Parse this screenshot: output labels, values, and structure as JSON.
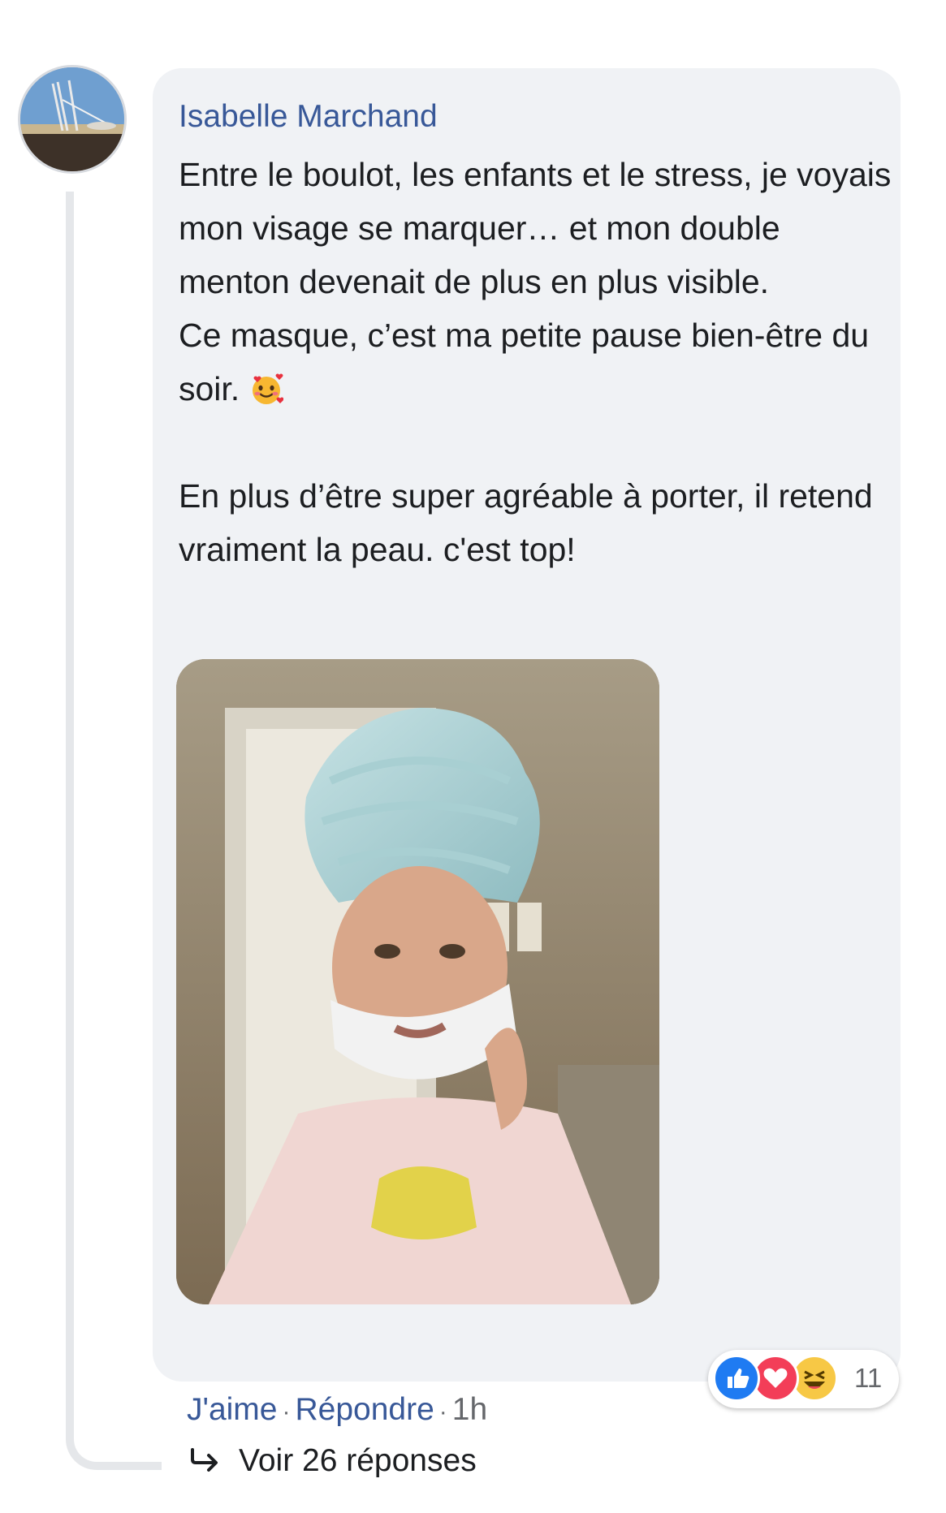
{
  "comment": {
    "author": "Isabelle Marchand",
    "paragraphs": [
      "Entre le boulot, les enfants et le stress, je voyais mon visage se marquer… et mon double menton devenait de plus en plus visible.",
      "Ce masque, c’est ma petite pause bien-être du soir.",
      "En plus d’être super agréable à porter, il retend vraiment la peau. c'est top!"
    ],
    "emoji": "smiling-face-with-hearts-icon"
  },
  "reactions": {
    "types": [
      "like-icon",
      "love-icon",
      "haha-icon"
    ],
    "count": "11",
    "colors": {
      "like": "#1f7bf2",
      "love": "#f33e58",
      "haha": "#f7c845"
    }
  },
  "actions": {
    "like": "J'aime",
    "separator": "·",
    "reply": "Répondre",
    "time": "1h"
  },
  "replies": {
    "label": "Voir 26 réponses"
  },
  "colors": {
    "bubble": "#f0f2f5",
    "link": "#385898",
    "text": "#1c1e21",
    "muted": "#65676b"
  }
}
